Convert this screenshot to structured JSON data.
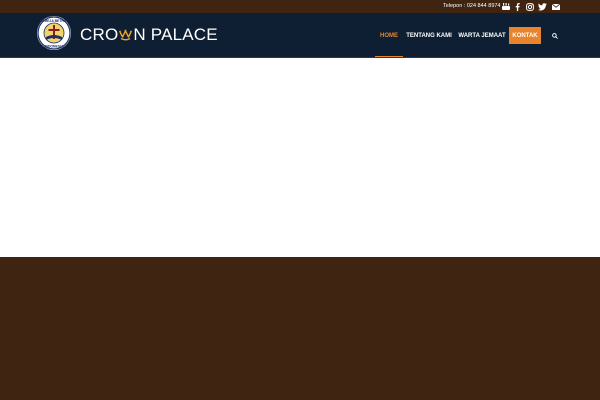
{
  "colors": {
    "brown_bg": "#3e2411",
    "header_navy": "#0f1f33",
    "accent_orange": "#e8852c",
    "content_bg": "#ffffff"
  },
  "topbar": {
    "phone": "Telepon : 024 844 8974",
    "social_icons": [
      "youtube-icon",
      "facebook-icon",
      "instagram-icon",
      "twitter-icon",
      "mail-icon"
    ]
  },
  "header": {
    "seal_text_top": "GEREJA BETHEL",
    "seal_text_bottom": "INDONESIA",
    "brand_part1": "CRO",
    "brand_part2": "N PALACE",
    "nav": {
      "home": "HOME",
      "about": "TENTANG KAMI",
      "news": "WARTA JEMAAT",
      "contact": "KONTAK"
    },
    "search_icon": "search-icon"
  }
}
